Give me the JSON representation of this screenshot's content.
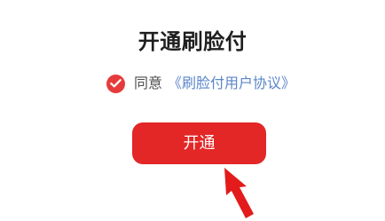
{
  "page": {
    "title": "开通刷脸付"
  },
  "agreement": {
    "prefix": "同意",
    "link_text": "《刷脸付用户协议》",
    "checked": true
  },
  "actions": {
    "open_button": "开通"
  },
  "colors": {
    "accent": "#e32626",
    "check": "#e63b3b",
    "link": "#5b85c9",
    "title": "#1f1f1f",
    "text": "#505050",
    "background": "#ffffff"
  },
  "icons": {
    "check": "check-icon",
    "pointer": "arrow-pointer-icon"
  }
}
